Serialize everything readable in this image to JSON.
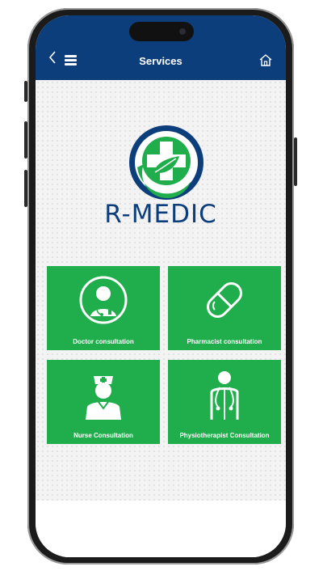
{
  "header": {
    "title": "Services",
    "back_icon": "chevron-left",
    "menu_icon": "hamburger-menu",
    "home_icon": "home"
  },
  "brand": {
    "name": "R-MEDIC",
    "colors": {
      "primary": "#0d3e7c",
      "accent": "#1fae4b"
    }
  },
  "services": [
    {
      "label": "Doctor consultation",
      "icon": "doctor-icon"
    },
    {
      "label": "Pharmacist consultation",
      "icon": "pill-icon"
    },
    {
      "label": "Nurse Consultation",
      "icon": "nurse-icon"
    },
    {
      "label": "Physiotherapist Consultation",
      "icon": "physiotherapist-icon"
    }
  ]
}
